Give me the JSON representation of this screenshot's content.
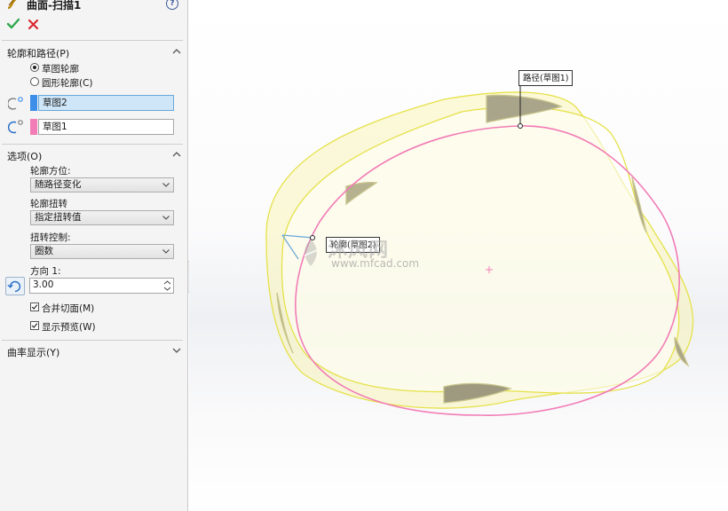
{
  "app": {
    "feature_title": "曲面-扫描1",
    "help_glyph": "?",
    "feature_icon": "sweep-surface-icon",
    "ok_icon": "green-check-icon",
    "cancel_icon": "red-x-icon",
    "colors": {
      "ok": "#2fa84f",
      "cancel": "#d9282f",
      "path_curve": "#f27cb6",
      "surface_edge": "#e6e14a",
      "profile_swatch": "#3d8ee8",
      "path_swatch": "#f27cb6"
    }
  },
  "profile_path": {
    "header": "轮廓和路径(P)",
    "radio_sketch": "草图轮廓",
    "radio_circle": "圆形轮廓(C)",
    "profile_value": "草图2",
    "path_value": "草图1",
    "profile_icon": "profile-select-icon",
    "path_icon": "path-select-icon"
  },
  "options": {
    "header": "选项(O)",
    "orientation_label": "轮廓方位:",
    "orientation_value": "随路径变化",
    "twist_label": "轮廓扭转",
    "twist_value": "指定扭转值",
    "twist_control_label": "扭转控制:",
    "twist_control_value": "圈数",
    "direction_label": "方向 1:",
    "direction_value": "3.00",
    "merge_label": "合并切面(M)",
    "preview_label": "显示预览(W)",
    "merge_checked": true,
    "preview_checked": true
  },
  "curvature": {
    "header": "曲率显示(Y)"
  },
  "viewport": {
    "path_callout": "路径(草图1)",
    "profile_callout": "轮廓(草图2)",
    "watermark_main": "沐风网",
    "watermark_url": "www.mfcad.com"
  }
}
